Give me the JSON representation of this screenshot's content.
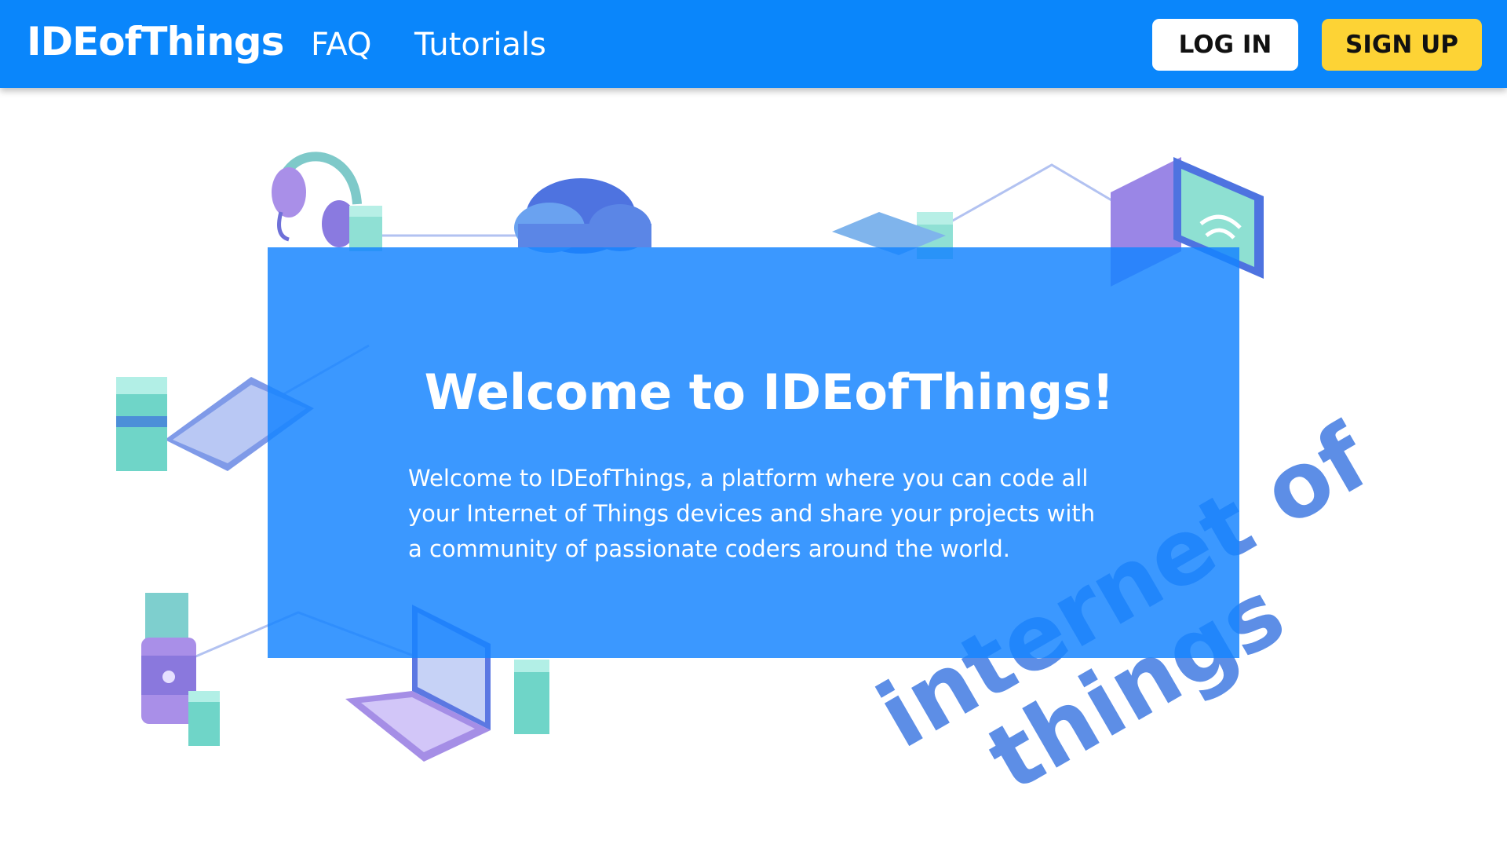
{
  "navbar": {
    "brand": "IDEofThings",
    "links": [
      {
        "label": "FAQ"
      },
      {
        "label": "Tutorials"
      }
    ],
    "login_label": "LOG IN",
    "signup_label": "SIGN UP"
  },
  "hero": {
    "title": "Welcome to IDEofThings!",
    "description": "Welcome to IDEofThings, a platform where you can code all your Internet of Things devices and share your projects with a community of passionate coders around the world.",
    "illustration_text": {
      "line1": "internet of",
      "line2": "things"
    }
  },
  "colors": {
    "navbar": "#0a86fb",
    "signup_button": "#fdd335",
    "login_button": "#ffffff",
    "card_overlay": "#1684ff"
  }
}
